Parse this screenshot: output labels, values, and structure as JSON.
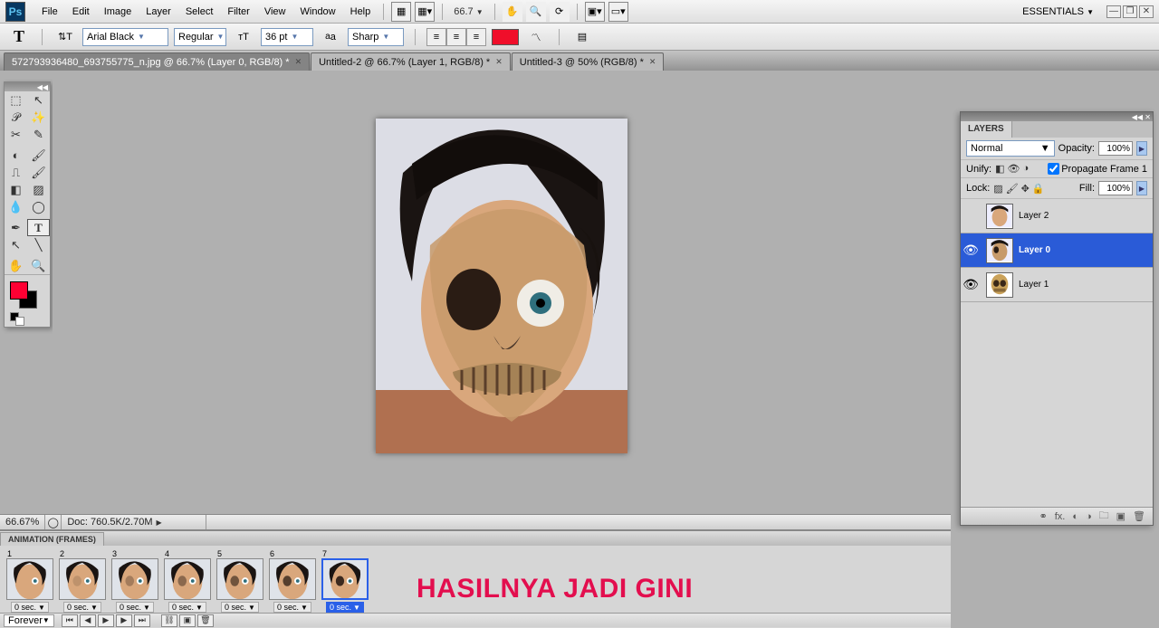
{
  "menubar": {
    "items": [
      "File",
      "Edit",
      "Image",
      "Layer",
      "Select",
      "Filter",
      "View",
      "Window",
      "Help"
    ],
    "zoom": "66.7",
    "workspace": "ESSENTIALS"
  },
  "optionsbar": {
    "font_family": "Arial Black",
    "font_style": "Regular",
    "font_size": "36 pt",
    "antialias": "Sharp",
    "color": "#f00e2a"
  },
  "doctabs": [
    {
      "title": "572793936480_693755775_n.jpg @ 66.7% (Layer 0, RGB/8) *",
      "active": true
    },
    {
      "title": "Untitled-2 @ 66.7% (Layer 1, RGB/8) *",
      "active": false
    },
    {
      "title": "Untitled-3 @ 50% (RGB/8) *",
      "active": false
    }
  ],
  "status": {
    "zoom": "66.67%",
    "docinfo": "Doc: 760.5K/2.70M"
  },
  "animation": {
    "panel_title": "ANIMATION (FRAMES)",
    "loop": "Forever",
    "frames": [
      {
        "n": "1",
        "delay": "0 sec."
      },
      {
        "n": "2",
        "delay": "0 sec."
      },
      {
        "n": "3",
        "delay": "0 sec."
      },
      {
        "n": "4",
        "delay": "0 sec."
      },
      {
        "n": "5",
        "delay": "0 sec."
      },
      {
        "n": "6",
        "delay": "0 sec."
      },
      {
        "n": "7",
        "delay": "0 sec."
      }
    ],
    "selected_index": 6
  },
  "caption": "HASILNYA JADI GINI",
  "layers_panel": {
    "title": "LAYERS",
    "blend_mode": "Normal",
    "opacity": "100%",
    "fill": "100%",
    "unify_label": "Unify:",
    "lock_label": "Lock:",
    "opacity_label": "Opacity:",
    "fill_label": "Fill:",
    "propagate_label": "Propagate Frame 1",
    "layers": [
      {
        "name": "Layer 2",
        "visible": false,
        "selected": false
      },
      {
        "name": "Layer 0",
        "visible": true,
        "selected": true
      },
      {
        "name": "Layer 1",
        "visible": true,
        "selected": false
      }
    ]
  }
}
